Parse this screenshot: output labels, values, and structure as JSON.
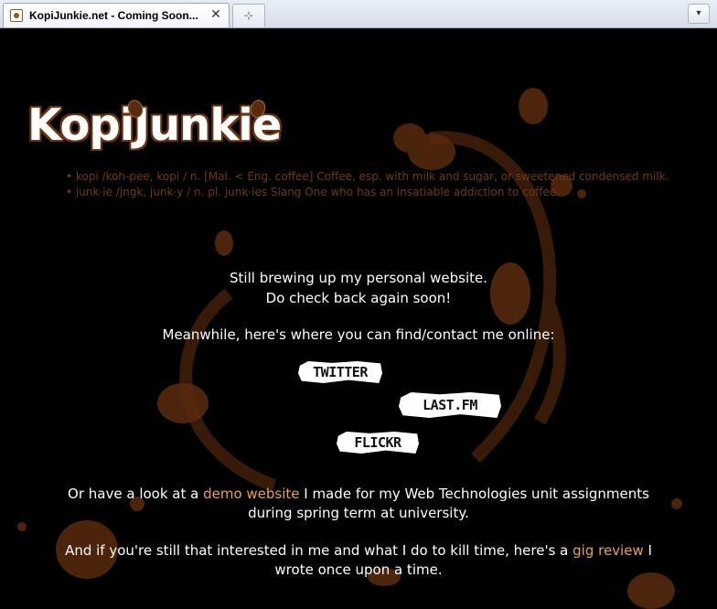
{
  "browser": {
    "tab_title": "KopiJunkie.net - Coming Soon...",
    "tab_close": "✕",
    "new_tab": "⊹",
    "tab_menu": "▾"
  },
  "header": {
    "logo_text": "KopiJunkie",
    "definitions": [
      "• kopi /koh-pee,  kopi / n. [Mal. < Eng. coffee]  Coffee, esp. with milk and sugar, or sweetened condensed milk.",
      "• junk·ie /jngk, junk·y / n. pl. junk·ies Slang  One who has an insatiable addiction to coffee."
    ]
  },
  "main": {
    "intro_line1": "Still brewing up my personal website.",
    "intro_line2": "Do check back again soon!",
    "meanwhile": "Meanwhile, here's where you can find/contact me online:",
    "social": {
      "twitter": "TWITTER",
      "lastfm": "LAST.FM",
      "flickr": "FLICKR"
    },
    "demo_before": "Or have a look at a ",
    "demo_link": "demo website",
    "demo_after": " I made for my Web Technologies unit assignments",
    "demo_line2": "during spring term at university.",
    "gig_before": "And if you're still that interested in me and what I do to kill time, here's a ",
    "gig_link": "gig review",
    "gig_after": " I",
    "gig_line2": "wrote once upon a time."
  },
  "colors": {
    "background": "#000000",
    "stain": "#5a2a0e",
    "link": "#e8a24a",
    "definition_text": "#6e3a18"
  }
}
